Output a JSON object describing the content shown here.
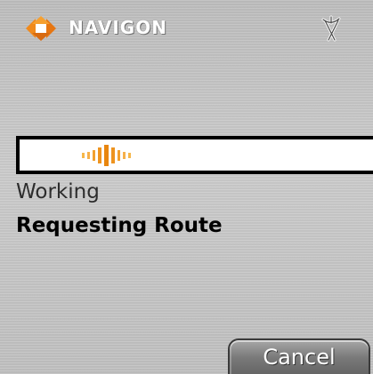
{
  "header": {
    "brand": "NAVIGON",
    "logo_icon": "navigon-diamond-logo-icon",
    "status_icon": "satellite-antenna-icon"
  },
  "progress": {
    "state": "indeterminate",
    "indicator_color": "#f0a020"
  },
  "status": {
    "heading": "Working",
    "message": "Requesting Route"
  },
  "actions": {
    "cancel_label": "Cancel"
  },
  "colors": {
    "background": "#c9c9c9",
    "brand_orange": "#f08a1c",
    "text_dark": "#000000"
  }
}
